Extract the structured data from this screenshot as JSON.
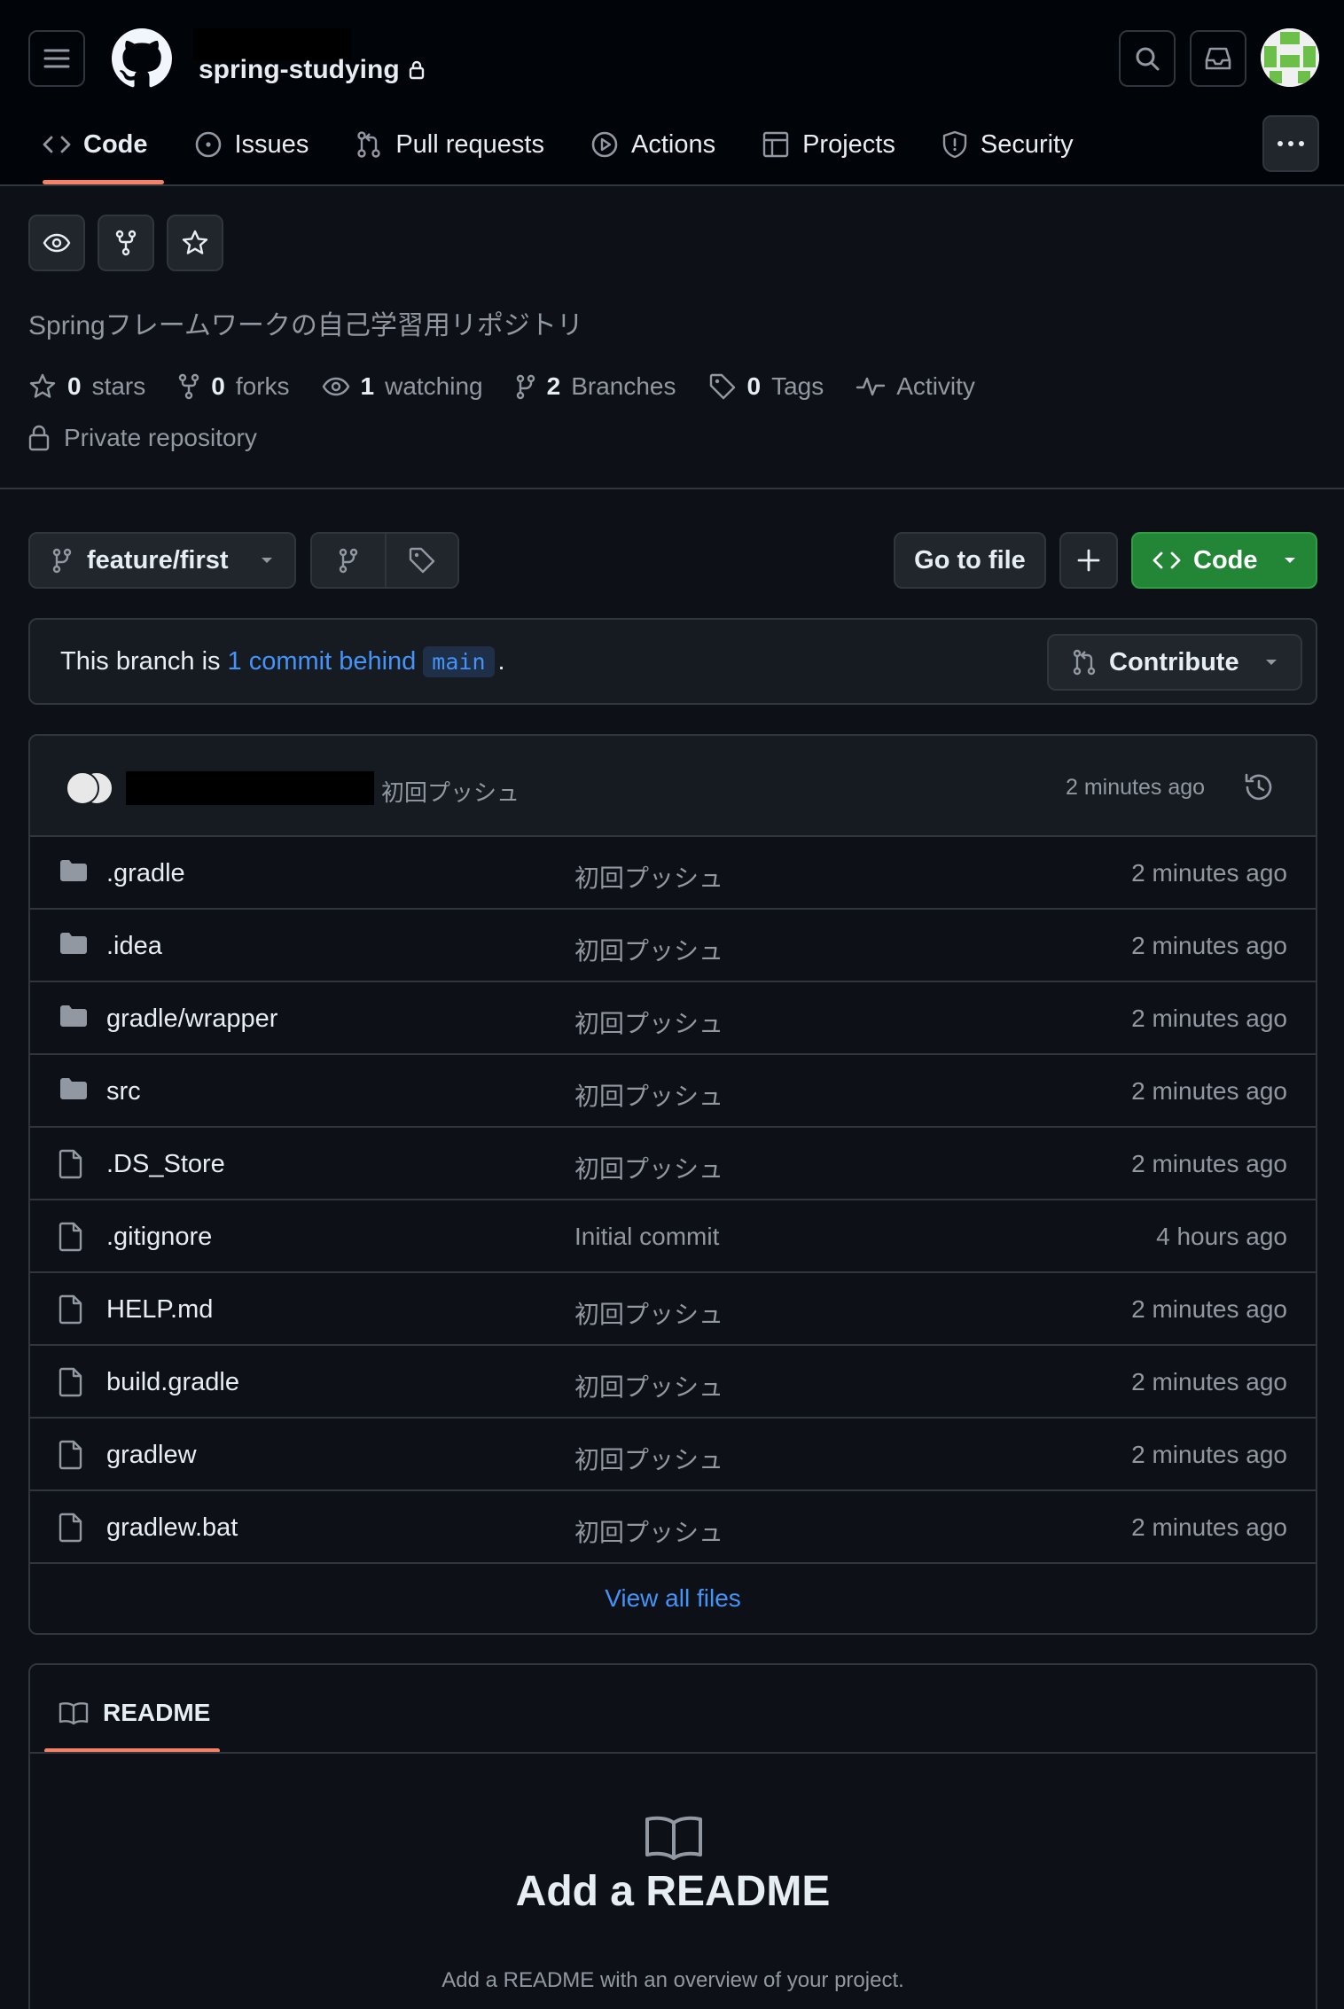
{
  "header": {
    "repo_name": "spring-studying",
    "tabs": [
      {
        "label": "Code",
        "icon": "code-icon",
        "active": true
      },
      {
        "label": "Issues",
        "icon": "issue-icon"
      },
      {
        "label": "Pull requests",
        "icon": "pull-request-icon"
      },
      {
        "label": "Actions",
        "icon": "play-icon"
      },
      {
        "label": "Projects",
        "icon": "table-icon"
      },
      {
        "label": "Security",
        "icon": "shield-icon"
      }
    ]
  },
  "repo": {
    "description": "Springフレームワークの自己学習用リポジトリ",
    "stats": {
      "stars_count": "0",
      "stars_label": "stars",
      "forks_count": "0",
      "forks_label": "forks",
      "watching_count": "1",
      "watching_label": "watching",
      "branches_count": "2",
      "branches_label": "Branches",
      "tags_count": "0",
      "tags_label": "Tags",
      "activity_label": "Activity"
    },
    "visibility": "Private repository"
  },
  "toolbar": {
    "branch": "feature/first",
    "go_to_file": "Go to file",
    "code_button": "Code"
  },
  "branch_status": {
    "prefix": "This branch is",
    "link": "1 commit behind",
    "base": "main",
    "suffix": ".",
    "contribute": "Contribute"
  },
  "latest_commit": {
    "message": "初回プッシュ",
    "time": "2 minutes ago"
  },
  "files": [
    {
      "name": ".gradle",
      "type": "folder",
      "message": "初回プッシュ",
      "time": "2 minutes ago"
    },
    {
      "name": ".idea",
      "type": "folder",
      "message": "初回プッシュ",
      "time": "2 minutes ago"
    },
    {
      "name": "gradle/wrapper",
      "type": "folder",
      "message": "初回プッシュ",
      "time": "2 minutes ago"
    },
    {
      "name": "src",
      "type": "folder",
      "message": "初回プッシュ",
      "time": "2 minutes ago"
    },
    {
      "name": ".DS_Store",
      "type": "file",
      "message": "初回プッシュ",
      "time": "2 minutes ago"
    },
    {
      "name": ".gitignore",
      "type": "file",
      "message": "Initial commit",
      "time": "4 hours ago"
    },
    {
      "name": "HELP.md",
      "type": "file",
      "message": "初回プッシュ",
      "time": "2 minutes ago"
    },
    {
      "name": "build.gradle",
      "type": "file",
      "message": "初回プッシュ",
      "time": "2 minutes ago"
    },
    {
      "name": "gradlew",
      "type": "file",
      "message": "初回プッシュ",
      "time": "2 minutes ago"
    },
    {
      "name": "gradlew.bat",
      "type": "file",
      "message": "初回プッシュ",
      "time": "2 minutes ago"
    }
  ],
  "view_all": "View all files",
  "readme": {
    "tab": "README",
    "title": "Add a README",
    "subtitle": "Add a README with an overview of your project."
  },
  "colors": {
    "background": "#0d1117",
    "header_bg": "#010409",
    "border": "#30363d",
    "accent_link": "#4493f8",
    "primary_button": "#238636",
    "tab_underline": "#f78166"
  }
}
